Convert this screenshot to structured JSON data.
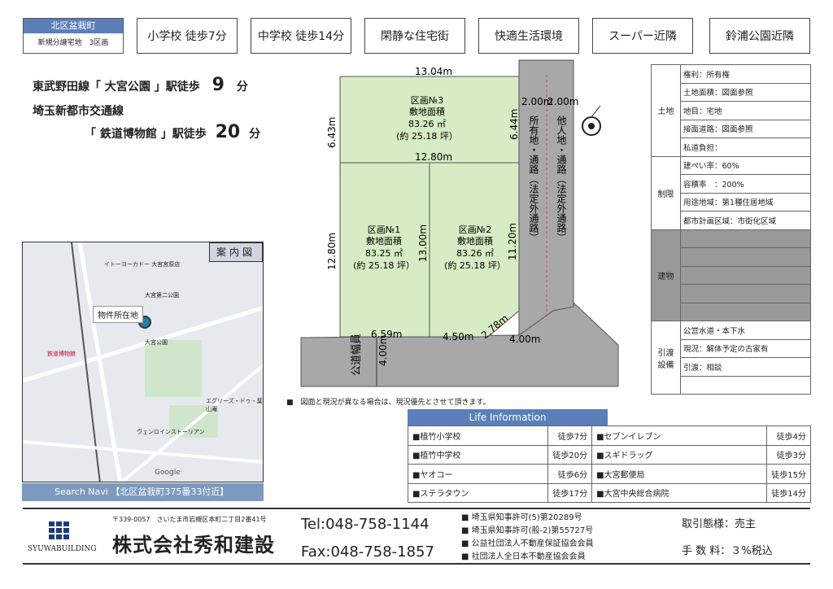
{
  "header": {
    "area": "北区盆栽町",
    "area_sub": "新規分譲宅地　3区画",
    "tags": [
      "小学校 徒歩7分",
      "中学校 徒歩14分",
      "閑静な住宅街",
      "快適生活環境",
      "スーパー近隣",
      "鈴浦公園近隣"
    ]
  },
  "access": {
    "line1_pre": "東武野田線「 大宮公園 」駅徒歩",
    "line1_num": "9",
    "line1_unit": "分",
    "line2_top": "埼玉新都市交通線",
    "line2_pre": "「 鉄道博物館 」駅徒歩",
    "line2_num": "20",
    "line2_unit": "分"
  },
  "plot": {
    "lot3": [
      "区画№3",
      "敷地面積",
      "83.26 ㎡",
      "(約 25.18 坪）"
    ],
    "lot1": [
      "区画№1",
      "敷地面積",
      "83.25 ㎡",
      "(約 25.18 坪）"
    ],
    "lot2": [
      "区画№2",
      "敷地面積",
      "83.26 ㎡",
      "(約 25.18 坪）"
    ],
    "dims": {
      "top": "13.04m",
      "mid": "12.80m",
      "left_top": "6.43m",
      "right_top": "6.44m",
      "left_bottom": "12.80m",
      "center": "13.00m",
      "right_bottom": "11.20m",
      "bottom_left": "6.59m",
      "bottom_mid": "4.50m",
      "corner": "2.78m",
      "road_right": "4.00m",
      "road_width": "4.00m",
      "w1": "2.00m",
      "w2": "2.00m"
    },
    "road_label": "公道幅員",
    "private_road": "所有地・通路（法定外通路）",
    "other_road": "他人地・通路（法定外通路）"
  },
  "info": {
    "land_cat": "土地",
    "land": [
      "権利：所有権",
      "土地面積：図面参照",
      "地目：宅地",
      "接面道路：図面参照",
      "私道負担："
    ],
    "limit_cat": "制限",
    "limit": [
      "建ぺい率：60%",
      "容積率　：200%",
      "用途地域：第1種住居地域",
      "都市計画区域：市街化区域"
    ],
    "building_cat": "建物",
    "deliver_cat": "引渡設備",
    "deliver": [
      "公営水道・本下水",
      "現況：解体予定の古家有",
      "引渡：相談"
    ]
  },
  "map": {
    "title": "案内図",
    "property_label": "物件所在地",
    "places": [
      "イトーヨーカドー 大宮宮原店",
      "大宮第二公園",
      "鉄道博物館",
      "大宮公園",
      "エグリーズ・ドゥ・葉山庵",
      "ヴェンロインストーリアン",
      "Google"
    ],
    "footer": "Search Navi 【北区盆栽町375番33付近】"
  },
  "note": "■　図面と現況が異なる場合は、現況優先とさせて頂きます。",
  "life": {
    "title": "Life Information",
    "rows": [
      [
        "■植竹小学校",
        "徒歩7分",
        "■セブンイレブン",
        "徒歩4分"
      ],
      [
        "■植竹中学校",
        "徒歩20分",
        "■スギドラッグ",
        "徒歩3分"
      ],
      [
        "■ヤオコー",
        "徒歩6分",
        "■大宮郵便局",
        "徒歩15分"
      ],
      [
        "■ステラタウン",
        "徒歩17分",
        "■大宮中央総合病院",
        "徒歩14分"
      ]
    ]
  },
  "footer": {
    "logo": "SYUWABUILDING",
    "address": "〒339-0057　さいたま市岩槻区本町二丁目2番41号",
    "company": "株式会社秀和建設",
    "tel": "Tel:048-758-1144",
    "fax": "Fax:048-758-1857",
    "licenses": [
      "■ 埼玉県知事許可(5)第20289号",
      "■ 埼玉県知事許可(般-2)第55727号",
      "■ 公益社団法人不動産保証協会会員",
      "■ 社団法人全日本不動産協会会員"
    ],
    "deal": "取引態様：売主",
    "fee": "手 数 料：３%税込"
  }
}
